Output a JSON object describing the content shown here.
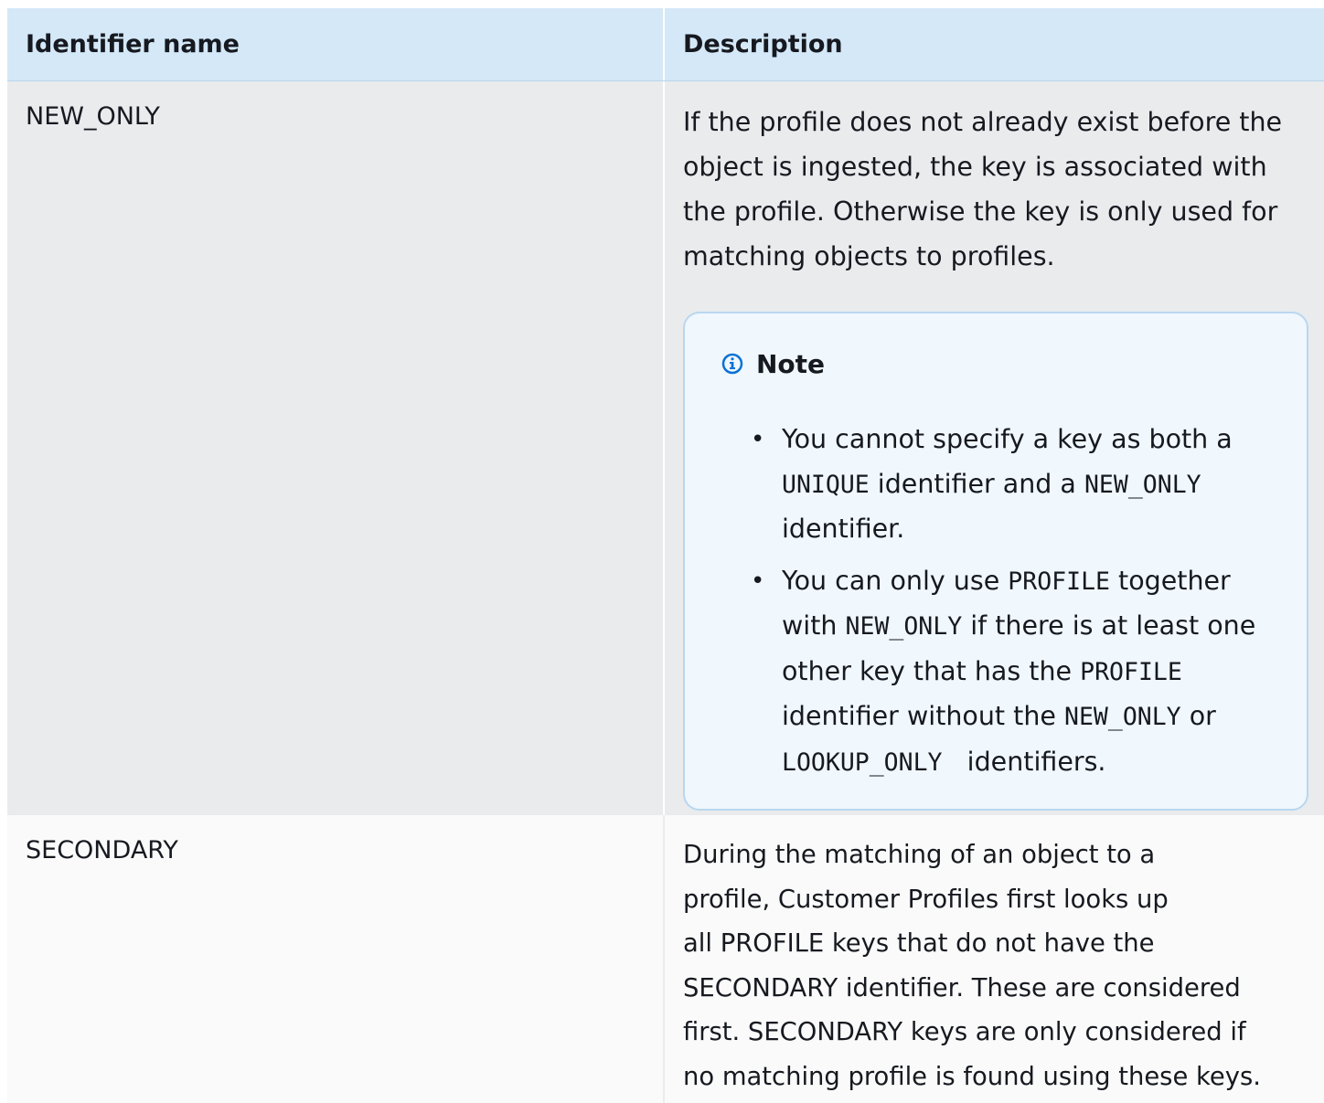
{
  "table": {
    "headers": [
      "Identifier name",
      "Description"
    ],
    "rows": [
      {
        "name": "NEW_ONLY",
        "description": "If the profile does not already exist before the object is ingested, the key is associated with the profile. Otherwise the key is only used for matching objects to profiles.",
        "note": {
          "title": "Note",
          "icon": "info-circle-icon",
          "items": [
            {
              "t1": "You cannot specify a key as both a ",
              "c1": "UNIQUE",
              "t2": " identifier and a ",
              "c2": "NEW_ONLY",
              "t3": " identifier."
            },
            {
              "t1": "You can only use ",
              "c1": "PROFILE",
              "t2": " together with ",
              "c2": "NEW_ONLY",
              "t3": " if there is at least one other key that has the ",
              "c3": "PROFILE",
              "t4": " identifier without the ",
              "c4": "NEW_ONLY",
              "t5": " or ",
              "c5": "LOOKUP_ONLY",
              "t6": "   identifiers."
            }
          ]
        }
      },
      {
        "name": "SECONDARY",
        "description_lines": [
          "During the matching of an object to a",
          "profile, Customer Profiles first looks up",
          "all PROFILE keys that do not have the",
          "SECONDARY identifier. These are considered",
          "first. SECONDARY keys are only considered if",
          "no matching profile is found using these keys."
        ]
      }
    ]
  },
  "colors": {
    "header_bg": "#d4e8f8",
    "row_alt_bg": "#e9ebed",
    "row_bg": "#fafafa",
    "note_bg": "#f0f7fd",
    "note_border": "#b9d7f0",
    "info_icon": "#0972d3"
  }
}
